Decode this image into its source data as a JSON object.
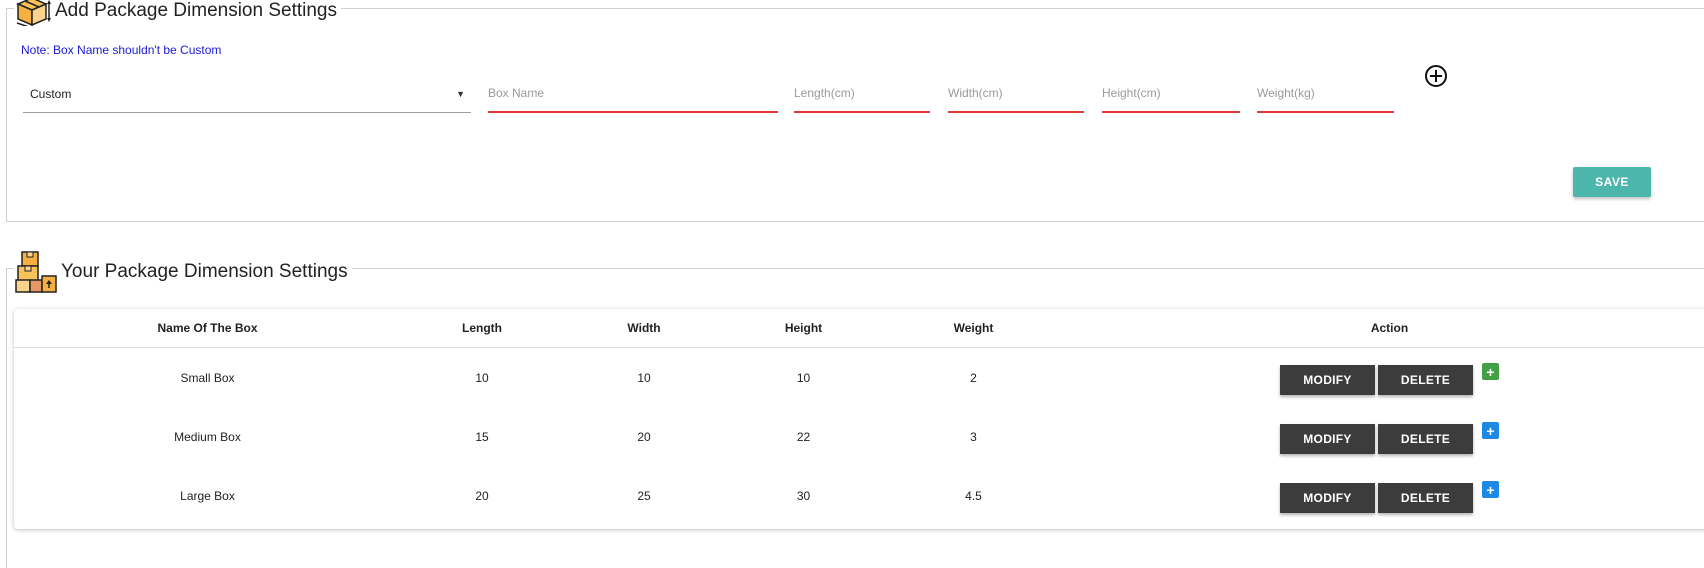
{
  "add_section": {
    "title": "Add Package Dimension Settings",
    "note": "Note: Box Name shouldn't be Custom",
    "box_type": {
      "selected": "Custom"
    },
    "fields": {
      "box_name": {
        "value": "",
        "placeholder": "Box Name"
      },
      "length": {
        "value": "",
        "placeholder": "Length(cm)"
      },
      "width": {
        "value": "",
        "placeholder": "Width(cm)"
      },
      "height": {
        "value": "",
        "placeholder": "Height(cm)"
      },
      "weight": {
        "value": "",
        "placeholder": "Weight(kg)"
      }
    },
    "save_label": "SAVE"
  },
  "list_section": {
    "title": "Your Package Dimension Settings",
    "columns": [
      "Name Of The Box",
      "Length",
      "Width",
      "Height",
      "Weight",
      "Action"
    ],
    "rows": [
      {
        "name": "Small Box",
        "length": "10",
        "width": "10",
        "height": "10",
        "weight": "2",
        "plus_color": "#43a047"
      },
      {
        "name": "Medium Box",
        "length": "15",
        "width": "20",
        "height": "22",
        "weight": "3",
        "plus_color": "#1e88e5"
      },
      {
        "name": "Large Box",
        "length": "20",
        "width": "25",
        "height": "30",
        "weight": "4.5",
        "plus_color": "#1e88e5"
      }
    ],
    "modify_label": "MODIFY",
    "delete_label": "DELETE",
    "plus_glyph": "+"
  },
  "colors": {
    "accent_teal": "#4db6ac",
    "error_red": "#e53935",
    "note_blue": "#1a1ad6",
    "button_dark": "#3c3c3c"
  },
  "icons": {
    "add_section": "package-box-icon",
    "list_section": "stacked-boxes-icon",
    "add_button": "circle-plus-icon"
  }
}
